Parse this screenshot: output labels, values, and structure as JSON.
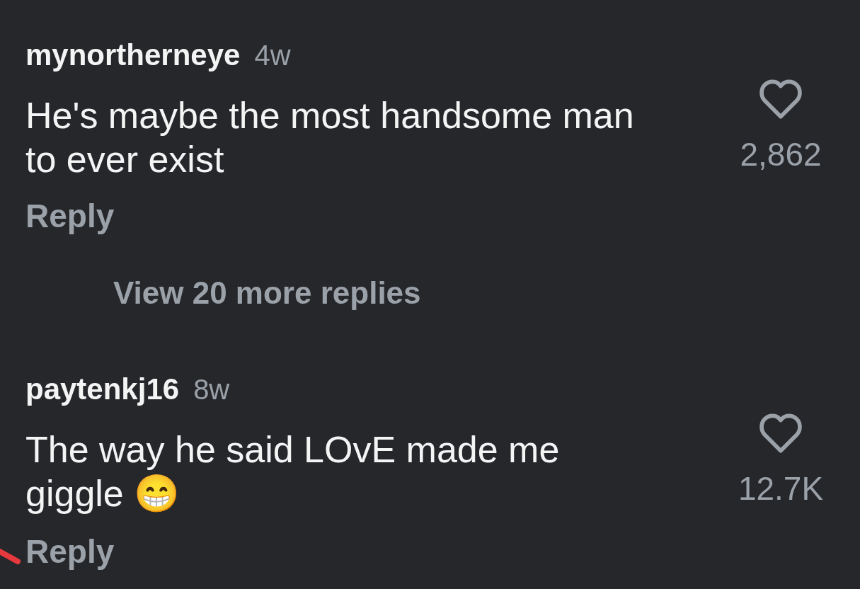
{
  "comments": [
    {
      "username": "mynortherneye",
      "time": "4w",
      "text": "He's maybe the most handsome man to ever exist",
      "liked": false,
      "likes": "2,862",
      "reply_label": "Reply",
      "more_replies": "View 20 more replies"
    },
    {
      "username": "paytenkj16",
      "time": "8w",
      "text": "The way he said LOvE made me giggle 😁",
      "liked": false,
      "likes": "12.7K",
      "reply_label": "Reply"
    }
  ]
}
